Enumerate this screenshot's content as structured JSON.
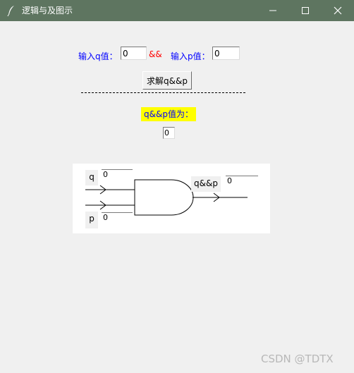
{
  "window": {
    "title": "逻辑与及图示"
  },
  "inputs": {
    "q_label": "输入q值：",
    "q_value": "0",
    "and_symbol": "&&",
    "p_label": "输入p值：",
    "p_value": "0"
  },
  "solve_button": {
    "label": "求解q&&p"
  },
  "result": {
    "label": "q&&p值为：",
    "value": "0"
  },
  "diagram": {
    "q_label": "q",
    "q_value": "0",
    "p_label": "p",
    "p_value": "0",
    "out_label": "q&&p",
    "out_value": "0"
  },
  "watermark": "CSDN @TDTX",
  "colors": {
    "titlebar": "#5e7560",
    "label_blue": "#0000ff",
    "and_red": "#ff0000",
    "result_highlight": "#ffff00"
  }
}
